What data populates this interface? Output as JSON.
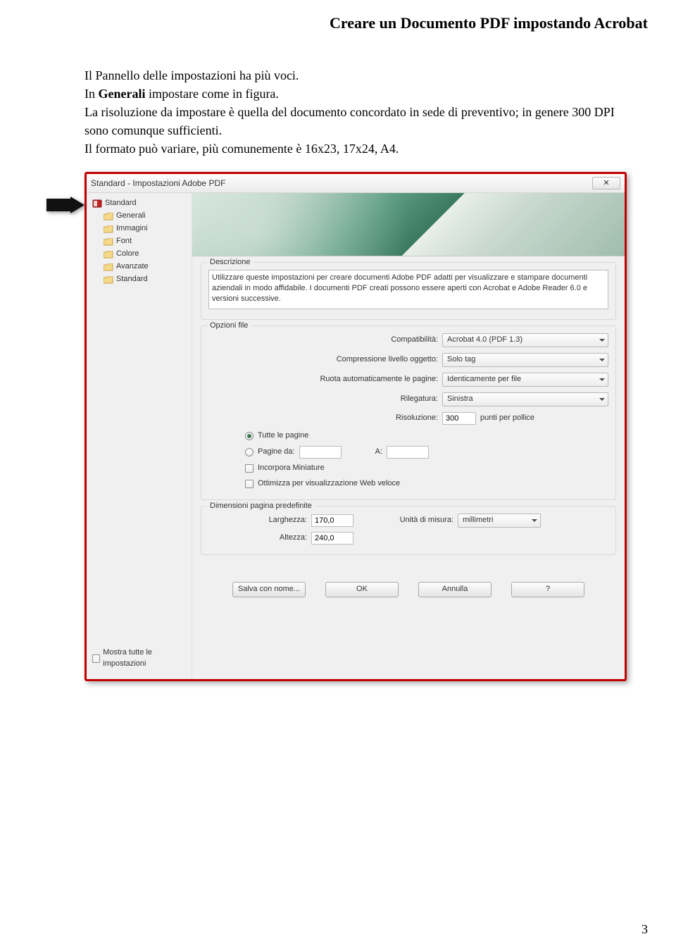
{
  "header_title": "Creare un Documento PDF impostando Acrobat",
  "body": {
    "p1": "Il Pannello delle impostazioni ha più voci.",
    "p2_prefix": "In ",
    "p2_bold": "Generali",
    "p2_suffix": " impostare come in figura.",
    "p3": "La risoluzione da impostare è quella del documento concordato in sede di preventivo; in genere 300 DPI sono comunque sufficienti.",
    "p4": "Il formato può variare, più comunemente è 16x23, 17x24, A4."
  },
  "dialog": {
    "title": "Standard - Impostazioni Adobe PDF",
    "close_glyph": "✕",
    "tree": {
      "root": "Standard",
      "items": [
        "Generali",
        "Immagini",
        "Font",
        "Colore",
        "Avanzate",
        "Standard"
      ]
    },
    "show_all": "Mostra tutte le impostazioni",
    "desc": {
      "legend": "Descrizione",
      "text": "Utilizzare queste impostazioni per creare documenti Adobe PDF adatti per visualizzare e stampare documenti aziendali in modo affidabile. I documenti PDF creati possono essere aperti con Acrobat e Adobe Reader 6.0 e versioni successive."
    },
    "opts": {
      "legend": "Opzioni file",
      "compat_label": "Compatibilità:",
      "compat_value": "Acrobat 4.0 (PDF 1.3)",
      "compress_label": "Compressione livello oggetto:",
      "compress_value": "Solo tag",
      "rotate_label": "Ruota automaticamente le pagine:",
      "rotate_value": "Identicamente per file",
      "bind_label": "Rilegatura:",
      "bind_value": "Sinistra",
      "res_label": "Risoluzione:",
      "res_value": "300",
      "res_unit": "punti per pollice",
      "all_pages": "Tutte le pagine",
      "pages_from": "Pagine da:",
      "pages_to": "A:",
      "embed_thumb": "Incorpora Miniature",
      "fast_web": "Ottimizza per visualizzazione Web veloce"
    },
    "dims": {
      "legend": "Dimensioni pagina predefinite",
      "width_label": "Larghezza:",
      "width_value": "170,0",
      "unit_label": "Unità di misura:",
      "unit_value": "millimetri",
      "height_label": "Altezza:",
      "height_value": "240,0"
    },
    "buttons": {
      "save_as": "Salva con nome...",
      "ok": "OK",
      "cancel": "Annulla",
      "help": "?"
    }
  },
  "page_number": "3"
}
